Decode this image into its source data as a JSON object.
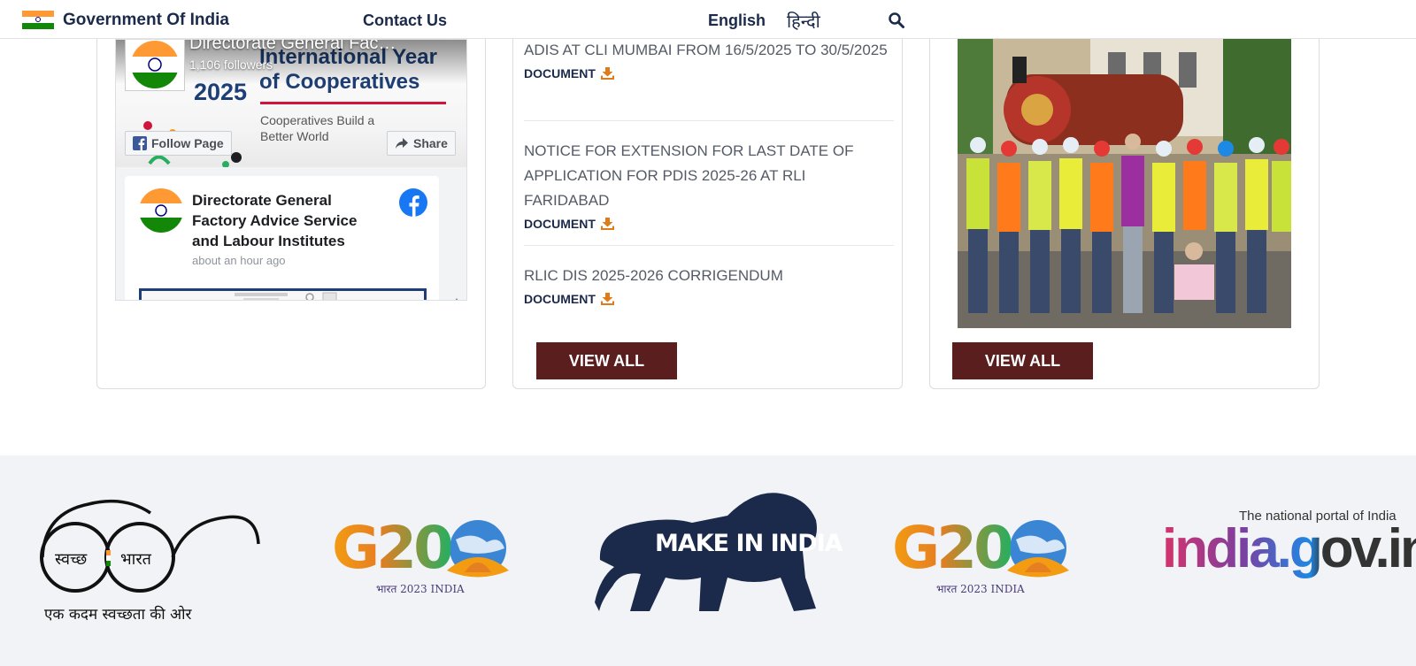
{
  "header": {
    "title": "Government Of India",
    "contact": "Contact Us",
    "lang_en": "English",
    "lang_hi": "हिन्दी",
    "search_icon": "search-icon"
  },
  "facebook": {
    "page_name": "Directorate General Fac…",
    "followers": "1,106 followers",
    "cover_year": "2025",
    "cover_title": "International Year of Cooperatives",
    "cover_subtitle": "Cooperatives Build a Better World",
    "follow_label": "Follow Page",
    "share_label": "Share",
    "post": {
      "author": "Directorate General Factory Advice Service and Labour Institutes",
      "time": "about an hour ago"
    }
  },
  "notices": {
    "doc_label": "DOCUMENT",
    "items": [
      {
        "title": "ADIS AT CLI MUMBAI FROM 16/5/2025 TO 30/5/2025"
      },
      {
        "title": "NOTICE FOR EXTENSION FOR LAST DATE OF APPLICATION FOR PDIS 2025-26 AT RLI FARIDABAD"
      },
      {
        "title": "RLIC DIS 2025-2026 CORRIGENDUM"
      }
    ],
    "view_all": "VIEW ALL"
  },
  "gallery": {
    "view_all": "VIEW ALL"
  },
  "footer_logos": {
    "swachh": {
      "line1": "स्वच्छ",
      "line2": "भारत",
      "tagline": "एक कदम स्वच्छता की ओर"
    },
    "g20": {
      "text": "G20",
      "sub": "भारत 2023 INDIA"
    },
    "make_in_india": "MAKE IN INDIA",
    "india_gov": {
      "top": "The national portal of India",
      "main": "india.gov.in"
    }
  },
  "colors": {
    "navy": "#1b2a4a",
    "maroon": "#5a1e1e",
    "doc_icon": "#e07b1a",
    "fb_blue": "#1877f2",
    "footer_bg": "#f1f3f6"
  }
}
